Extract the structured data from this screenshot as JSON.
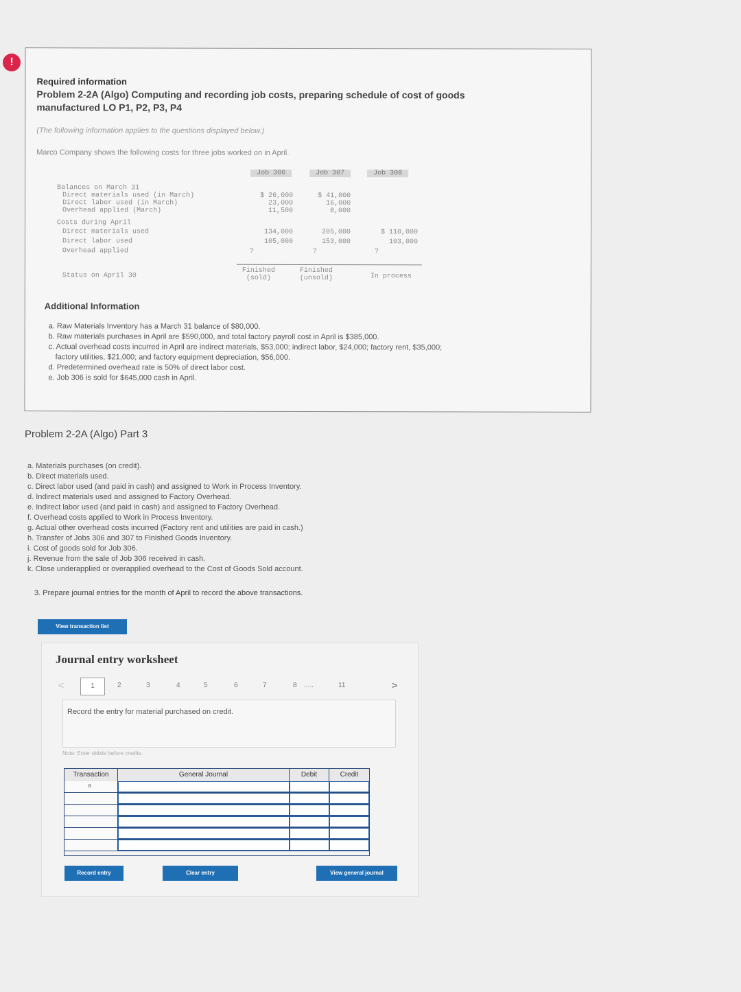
{
  "alert_badge": "!",
  "info": {
    "required_label": "Required information",
    "problem_title": "Problem 2-2A (Algo) Computing and recording job costs, preparing schedule of cost of goods manufactured LO P1, P2, P3, P4",
    "note": "(The following information applies to the questions displayed below.)",
    "intro": "Marco Company shows the following costs for three jobs worked on in April.",
    "table": {
      "headers": [
        "Job 306",
        "Job 307",
        "Job 308"
      ],
      "rows": [
        {
          "label": "Balances on March 31",
          "values": [
            "",
            "",
            ""
          ]
        },
        {
          "label": "  Direct materials used (in March)",
          "values": [
            "$ 26,000",
            "$ 41,000",
            ""
          ]
        },
        {
          "label": "  Direct labor used (in March)",
          "values": [
            "23,000",
            "16,000",
            ""
          ]
        },
        {
          "label": "  Overhead applied (March)",
          "values": [
            "11,500",
            "8,000",
            ""
          ]
        },
        {
          "label": "Costs during April",
          "values": [
            "",
            "",
            ""
          ]
        },
        {
          "label": "  Direct materials used",
          "values": [
            "134,000",
            "205,000",
            "$ 110,000"
          ]
        },
        {
          "label": "  Direct labor used",
          "values": [
            "105,000",
            "153,000",
            "103,000"
          ]
        },
        {
          "label": "  Overhead applied",
          "values": [
            "?",
            "?",
            "?"
          ]
        },
        {
          "label": "Status on April 30",
          "values": [
            "Finished (sold)",
            "Finished (unsold)",
            "In process"
          ]
        }
      ]
    },
    "additional_title": "Additional Information",
    "additional_items": [
      "a. Raw Materials Inventory has a March 31 balance of $80,000.",
      "b. Raw materials purchases in April are $590,000, and total factory payroll cost in April is $385,000.",
      "c. Actual overhead costs incurred in April are indirect materials, $53,000; indirect labor, $24,000; factory rent, $35,000;",
      "   factory utilities, $21,000; and factory equipment depreciation, $56,000.",
      "d. Predetermined overhead rate is 50% of direct labor cost.",
      "e. Job 306 is sold for $645,000 cash in April."
    ]
  },
  "part_title": "Problem 2-2A (Algo) Part 3",
  "transactions": [
    "a. Materials purchases (on credit).",
    "b. Direct materials used.",
    "c. Direct labor used (and paid in cash) and assigned to Work in Process Inventory.",
    "d. Indirect materials used and assigned to Factory Overhead.",
    "e. Indirect labor used (and paid in cash) and assigned to Factory Overhead.",
    "f. Overhead costs applied to Work in Process Inventory.",
    "g. Actual other overhead costs incurred (Factory rent and utilities are paid in cash.)",
    "h. Transfer of Jobs 306 and 307 to Finished Goods Inventory.",
    "i. Cost of goods sold for Job 306.",
    "j. Revenue from the sale of Job 306 received in cash.",
    "k. Close underapplied or overapplied overhead to the Cost of Goods Sold account."
  ],
  "prepare_text": "3. Prepare journal entries for the month of April to record the above transactions.",
  "buttons": {
    "view_transaction_list": "View transaction list",
    "record_entry": "Record entry",
    "clear_entry": "Clear entry",
    "view_general_journal": "View general journal"
  },
  "worksheet": {
    "title": "Journal entry worksheet",
    "pages": [
      "1",
      "2",
      "3",
      "4",
      "5",
      "6",
      "7",
      "8",
      ".....",
      "11"
    ],
    "prev_arrow": "<",
    "next_arrow": ">",
    "prompt": "Record the entry for material purchased on credit.",
    "note": "Note: Enter debits before credits.",
    "headers": {
      "transaction": "Transaction",
      "general_journal": "General Journal",
      "debit": "Debit",
      "credit": "Credit"
    },
    "first_transaction": "a"
  },
  "colors": {
    "accent": "#1f6fb5",
    "alert": "#d9254a",
    "table_border": "#2a4a7a"
  }
}
